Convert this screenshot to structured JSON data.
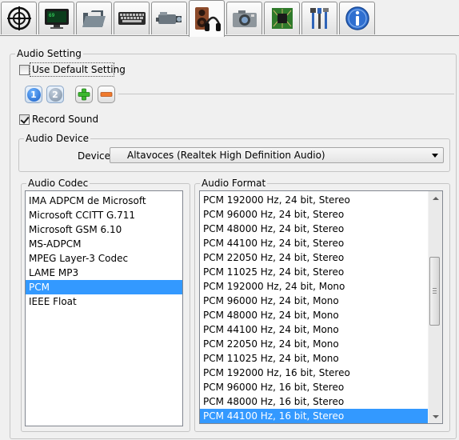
{
  "toolbar": {
    "tabs": [
      {
        "icon": "crosshair-icon"
      },
      {
        "icon": "monitor-icon"
      },
      {
        "icon": "folder-icon"
      },
      {
        "icon": "keyboard-icon"
      },
      {
        "icon": "video-camera-icon"
      },
      {
        "icon": "speaker-headphones-icon",
        "active": true
      },
      {
        "icon": "photo-camera-icon"
      },
      {
        "icon": "circuit-board-icon"
      },
      {
        "icon": "tools-icon"
      },
      {
        "icon": "info-icon"
      }
    ]
  },
  "audio_setting": {
    "legend": "Audio Setting",
    "use_default": {
      "label": "Use Default Setting",
      "checked": false
    },
    "profiles": [
      "1",
      "2"
    ],
    "active_profile": "1",
    "record_sound": {
      "label": "Record Sound",
      "checked": true
    }
  },
  "audio_device": {
    "legend": "Audio Device",
    "device_label": "Device",
    "device_value": "Altavoces (Realtek High Definition Audio)"
  },
  "audio_codec": {
    "legend": "Audio Codec",
    "items": [
      "IMA ADPCM de Microsoft",
      "Microsoft CCITT G.711",
      "Microsoft GSM 6.10",
      "MS-ADPCM",
      "MPEG Layer-3 Codec",
      "LAME MP3",
      "PCM",
      "IEEE Float"
    ],
    "selected": "PCM"
  },
  "audio_format": {
    "legend": "Audio Format",
    "items": [
      "PCM 192000 Hz, 24 bit, Stereo",
      "PCM 96000 Hz, 24 bit, Stereo",
      "PCM 48000 Hz, 24 bit, Stereo",
      "PCM 44100 Hz, 24 bit, Stereo",
      "PCM 22050 Hz, 24 bit, Stereo",
      "PCM 11025 Hz, 24 bit, Stereo",
      "PCM 192000 Hz, 24 bit, Mono",
      "PCM 96000 Hz, 24 bit, Mono",
      "PCM 48000 Hz, 24 bit, Mono",
      "PCM 44100 Hz, 24 bit, Mono",
      "PCM 22050 Hz, 24 bit, Mono",
      "PCM 11025 Hz, 24 bit, Mono",
      "PCM 192000 Hz, 16 bit, Stereo",
      "PCM 96000 Hz, 16 bit, Stereo",
      "PCM 48000 Hz, 16 bit, Stereo",
      "PCM 44100 Hz, 16 bit, Stereo"
    ],
    "selected": "PCM 44100 Hz, 16 bit, Stereo"
  },
  "colors": {
    "selection": "#3399ff",
    "window_bg": "#f0f0f0"
  }
}
